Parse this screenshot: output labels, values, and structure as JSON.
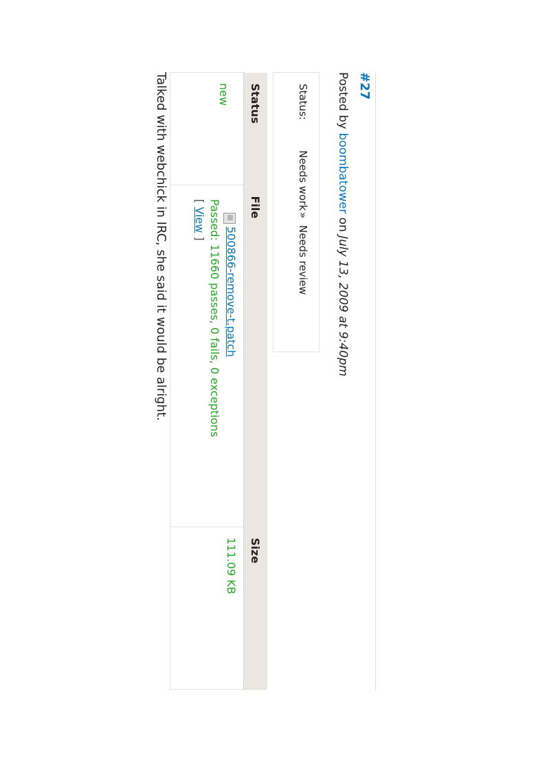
{
  "comment": {
    "number": "#27",
    "posted_prefix": "Posted by",
    "author": "boombatower",
    "on": "on",
    "date": "July 13, 2009 at 9:40pm",
    "status_change": {
      "label": "Status:",
      "old": "Needs work",
      "arrow": "»",
      "new": "Needs review"
    },
    "files_table": {
      "headers": [
        "Status",
        "File",
        "Size"
      ],
      "rows": [
        {
          "status": "new",
          "file_name": "500866-remove-t.patch",
          "test_result": "Passed: 11660 passes, 0 fails, 0 exceptions",
          "view_open": "[",
          "view_label": "View",
          "view_close": "]",
          "size": "111.09 KB"
        }
      ]
    },
    "body": "Talked with webchick in IRC, she said it would be alright."
  },
  "colors": {
    "link": "#0678be",
    "pass": "#22aa22",
    "header_bg": "#e8e7e0"
  }
}
